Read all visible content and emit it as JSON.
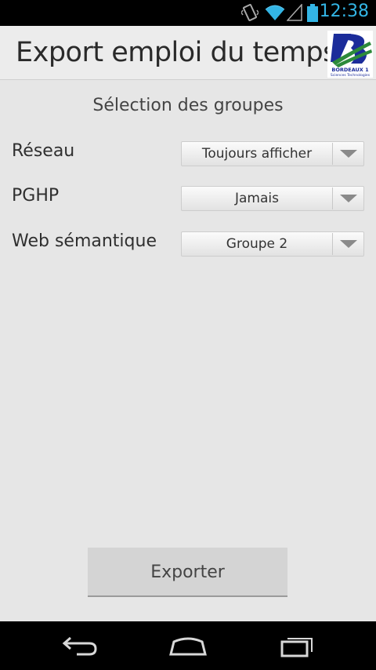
{
  "status_bar": {
    "time": "12:38",
    "icons": [
      "vibrate-icon",
      "wifi-icon",
      "signal-icon",
      "battery-icon"
    ],
    "accent_color": "#33b5e5"
  },
  "header": {
    "title": "Export emploi du temps",
    "logo_text": "BORDEAUX 1",
    "logo_subtext": "Sciences Technologies"
  },
  "main": {
    "section_title": "Sélection des groupes",
    "groups": [
      {
        "label": "Réseau",
        "value": "Toujours afficher"
      },
      {
        "label": "PGHP",
        "value": "Jamais"
      },
      {
        "label": "Web sémantique",
        "value": "Groupe 2"
      }
    ],
    "export_label": "Exporter"
  },
  "nav_bar": {
    "buttons": [
      "back-icon",
      "home-icon",
      "recent-apps-icon"
    ]
  }
}
